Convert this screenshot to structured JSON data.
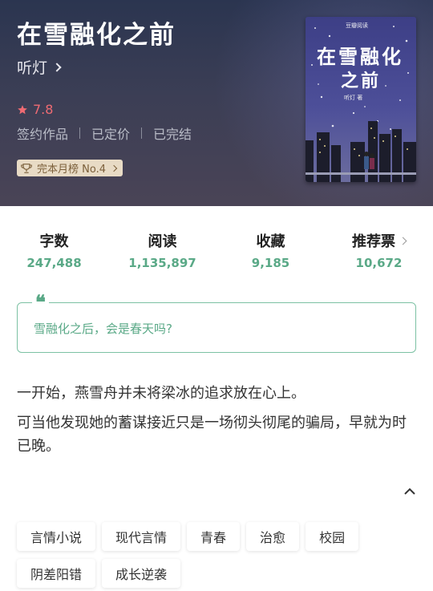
{
  "book": {
    "title": "在雪融化之前",
    "author": "听灯",
    "rating": "7.8",
    "meta": [
      "签约作品",
      "已定价",
      "已完结"
    ],
    "rank": "完本月榜 No.4"
  },
  "cover": {
    "publisher": "豆瓣阅读",
    "title_line1": "在雪融化",
    "title_line2": "之前",
    "author_line": "听灯 著"
  },
  "stats": [
    {
      "label": "字数",
      "value": "247,488"
    },
    {
      "label": "阅读",
      "value": "1,135,897"
    },
    {
      "label": "收藏",
      "value": "9,185"
    },
    {
      "label": "推荐票",
      "value": "10,672"
    }
  ],
  "quote": "雪融化之后，会是春天吗?",
  "description": [
    "一开始，燕雪舟并未将梁冰的追求放在心上。",
    "可当他发现她的蓄谋接近只是一场彻头彻尾的骗局，早就为时已晚。"
  ],
  "tags": [
    "言情小说",
    "现代言情",
    "青春",
    "治愈",
    "校园",
    "阴差阳错",
    "成长逆袭"
  ],
  "icons": {
    "star": "star-icon",
    "trophy": "trophy-icon",
    "collapse": "chevron-up-icon"
  },
  "colors": {
    "accent_green": "#5aa987",
    "rating_red": "#ef6b73"
  }
}
